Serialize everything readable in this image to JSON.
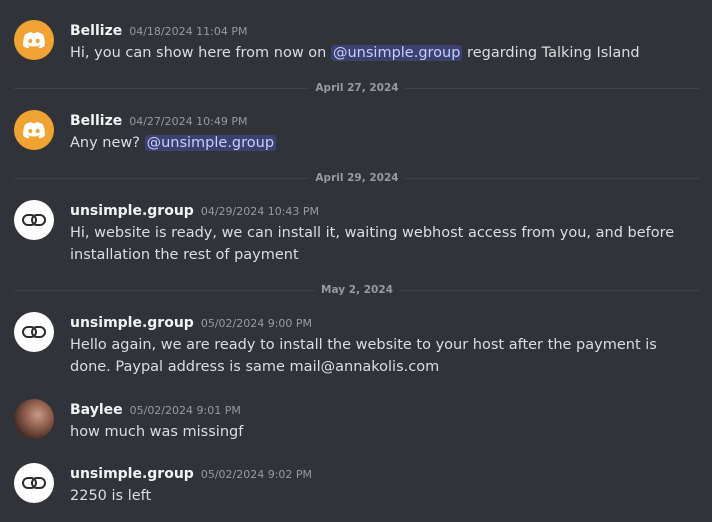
{
  "messages": [
    {
      "author": "Bellize",
      "timestamp": "04/18/2024 11:04 PM",
      "avatar_icon": "discord-logo-icon",
      "text_before": "Hi, you can show here from now on ",
      "mention": "@unsimple.group",
      "text_after": " regarding Talking Island"
    },
    {
      "author": "Bellize",
      "timestamp": "04/27/2024 10:49 PM",
      "avatar_icon": "discord-logo-icon",
      "text_before": "Any new? ",
      "mention": "@unsimple.group"
    },
    {
      "author": "unsimple.group",
      "timestamp": "04/29/2024 10:43 PM",
      "avatar_icon": "chain-link-icon",
      "text": "Hi, website is ready, we can install it, waiting webhost access from you, and before installation the rest of payment"
    },
    {
      "author": "unsimple.group",
      "timestamp": "05/02/2024 9:00 PM",
      "avatar_icon": "chain-link-icon",
      "text": "Hello again, we are ready to install the website to your host after the payment is done. Paypal address is same mail@annakolis.com"
    },
    {
      "author": "Baylee",
      "timestamp": "05/02/2024 9:01 PM",
      "avatar_icon": "user-photo",
      "text": "how much was missingf"
    },
    {
      "author": "unsimple.group",
      "timestamp": "05/02/2024 9:02 PM",
      "avatar_icon": "chain-link-icon",
      "text": "2250 is left"
    }
  ],
  "dividers": [
    {
      "label": "April 27, 2024"
    },
    {
      "label": "April 29, 2024"
    },
    {
      "label": "May 2, 2024"
    }
  ],
  "colors": {
    "background": "#313338",
    "discord_avatar": "#f0a232",
    "mention_bg": "#3c4270",
    "mention_text": "#c9cdfb"
  }
}
